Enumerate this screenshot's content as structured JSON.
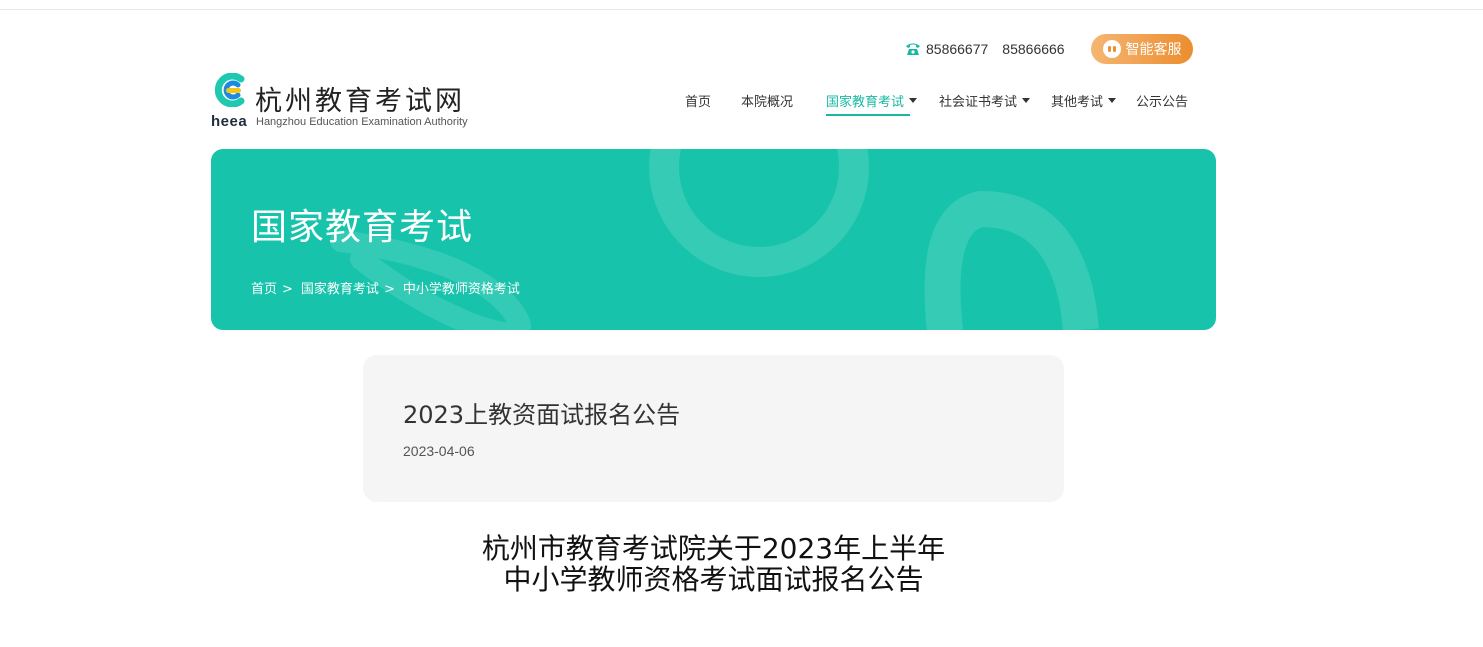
{
  "header": {
    "phones": [
      "85866677",
      "85866666"
    ],
    "service_label": "智能客服"
  },
  "logo": {
    "mark_text": "heea",
    "name_cn": "杭州教育考试网",
    "name_en": "Hangzhou Education Examination Authority"
  },
  "nav": {
    "items": [
      {
        "label": "首页",
        "dropdown": false,
        "active": false
      },
      {
        "label": "本院概况",
        "dropdown": false,
        "active": false
      },
      {
        "label": "国家教育考试",
        "dropdown": true,
        "active": true
      },
      {
        "label": "社会证书考试",
        "dropdown": true,
        "active": false
      },
      {
        "label": "其他考试",
        "dropdown": true,
        "active": false
      },
      {
        "label": "公示公告",
        "dropdown": false,
        "active": false
      }
    ]
  },
  "banner": {
    "title": "国家教育考试",
    "breadcrumb": [
      "首页",
      "国家教育考试",
      "中小学教师资格考试"
    ],
    "separator": ">"
  },
  "article": {
    "title": "2023上教资面试报名公告",
    "date": "2023-04-06",
    "heading_lines": [
      "杭州市教育考试院关于2023年上半年",
      "中小学教师资格考试面试报名公告"
    ]
  },
  "colors": {
    "brand_teal": "#17c4ab",
    "nav_active": "#17b9a2",
    "service_orange": "#ec8d2f"
  },
  "icons": [
    "phone-icon",
    "smiley-chat-icon",
    "caret-down-icon"
  ]
}
